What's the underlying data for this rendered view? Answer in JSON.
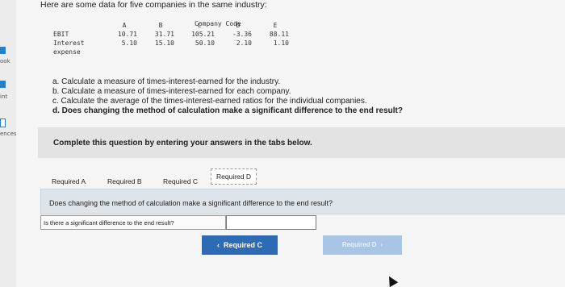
{
  "intro_text": "Here are some data for five companies in the same industry:",
  "sidebar": {
    "items": [
      {
        "label": "ook"
      },
      {
        "label": "int"
      },
      {
        "label": "ences"
      }
    ],
    "accent": "#2a7fc0"
  },
  "table": {
    "group_header": "Company Code",
    "columns": [
      "A",
      "B",
      "C",
      "D",
      "E"
    ],
    "rows": [
      {
        "label": "EBIT",
        "values": [
          "10.71",
          "31.71",
          "105.21",
          "-3.36",
          "88.11"
        ]
      },
      {
        "label": "Interest",
        "label2": "expense",
        "values": [
          "5.10",
          "15.10",
          "50.10",
          "2.10",
          "1.10"
        ]
      }
    ]
  },
  "questions": [
    "a. Calculate a measure of times-interest-earned for the industry.",
    "b. Calculate a measure of times-interest-earned for each company.",
    "c. Calculate the average of the times-interest-earned ratios for the individual companies.",
    "d. Does changing the method of calculation make a significant difference to the end result?"
  ],
  "instruction": "Complete this question by entering your answers in the tabs below.",
  "tabs": [
    "Required A",
    "Required B",
    "Required C",
    "Required D"
  ],
  "active_tab": "Required D",
  "panel_question": "Does changing the method of calculation make a significant difference to the end result?",
  "prompt_label": "Is there a significant difference to the end result?",
  "answer_value": "",
  "nav": {
    "prev_label": "Required C",
    "prev_glyph": "‹",
    "next_label": "Required D",
    "next_glyph": "›",
    "primary_color": "#2d6cb5",
    "disabled_color": "#a9c5e6"
  }
}
